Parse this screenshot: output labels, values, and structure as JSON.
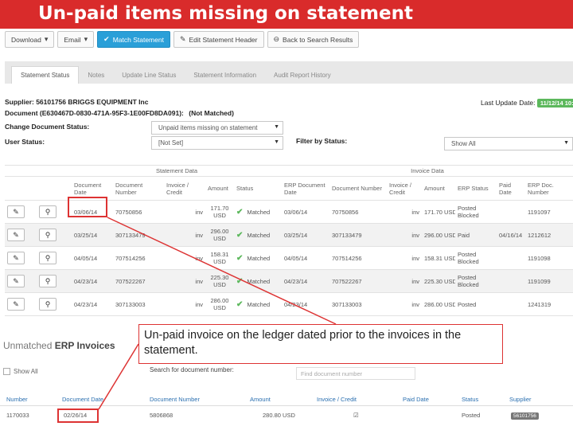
{
  "slide_title": "Un-paid items missing on statement",
  "toolbar": [
    {
      "label": "Download",
      "icon": "caret-down-icon",
      "glyph": "▾"
    },
    {
      "label": "Email",
      "icon": "caret-down-icon",
      "glyph": "▾"
    },
    {
      "label": "Match Statement",
      "icon": "check-circle-icon",
      "glyph": "✔",
      "primary": true
    },
    {
      "label": "Edit Statement Header",
      "icon": "edit-icon",
      "glyph": "✎"
    },
    {
      "label": "Back to Search Results",
      "icon": "back-arrow-icon",
      "glyph": "⊖"
    }
  ],
  "tabs": [
    {
      "label": "Statement Status",
      "active": true
    },
    {
      "label": "Notes"
    },
    {
      "label": "Update Line Status"
    },
    {
      "label": "Statement Information"
    },
    {
      "label": "Audit Report History"
    }
  ],
  "header": {
    "supplier": "Supplier: 56101756 BRIGGS EQUIPMENT Inc",
    "document": "Document (E630467D-0830-471A-95F3-1E00FD8DA091):",
    "doc_status": "(Not Matched)",
    "last_update_label": "Last Update Date:",
    "last_update_value": "11/12/14 10:04",
    "change_status_label": "Change Document Status:",
    "change_status_value": "Unpaid items missing on statement",
    "user_status_label": "User Status:",
    "user_status_value": "[Not Set]",
    "filter_label": "Filter by Status:",
    "filter_value": "Show All"
  },
  "statement_table": {
    "group_statement": "Statement Data",
    "group_invoice": "Invoice Data",
    "columns": [
      "",
      "",
      "Document Date",
      "Document Number",
      "Invoice / Credit",
      "Amount",
      "Status",
      "ERP Document Date",
      "Document Number",
      "Invoice / Credit",
      "Amount",
      "ERP Status",
      "Paid Date",
      "ERP Doc. Number"
    ],
    "rows": [
      {
        "doc_date": "03/06/14",
        "doc_num": "70750856",
        "type": "inv",
        "amount": "171.70 USD",
        "status": "Matched",
        "erp_date": "03/06/14",
        "erp_num": "70750856",
        "erp_type": "inv",
        "erp_amount": "171.70 USD",
        "erp_status": "Posted Blocked",
        "paid_date": "",
        "erp_doc": "1191097"
      },
      {
        "doc_date": "03/25/14",
        "doc_num": "307133479",
        "type": "inv",
        "amount": "296.00 USD",
        "status": "Matched",
        "erp_date": "03/25/14",
        "erp_num": "307133479",
        "erp_type": "inv",
        "erp_amount": "296.00 USD",
        "erp_status": "Paid",
        "paid_date": "04/16/14",
        "erp_doc": "1212612"
      },
      {
        "doc_date": "04/05/14",
        "doc_num": "707514256",
        "type": "inv",
        "amount": "158.31 USD",
        "status": "Matched",
        "erp_date": "04/05/14",
        "erp_num": "707514256",
        "erp_type": "inv",
        "erp_amount": "158.31 USD",
        "erp_status": "Posted Blocked",
        "paid_date": "",
        "erp_doc": "1191098"
      },
      {
        "doc_date": "04/23/14",
        "doc_num": "707522267",
        "type": "inv",
        "amount": "225.30 USD",
        "status": "Matched",
        "erp_date": "04/23/14",
        "erp_num": "707522267",
        "erp_type": "inv",
        "erp_amount": "225.30 USD",
        "erp_status": "Posted Blocked",
        "paid_date": "",
        "erp_doc": "1191099"
      },
      {
        "doc_date": "04/23/14",
        "doc_num": "307133003",
        "type": "inv",
        "amount": "286.00 USD",
        "status": "Matched",
        "erp_date": "04/23/14",
        "erp_num": "307133003",
        "erp_type": "inv",
        "erp_amount": "286.00 USD",
        "erp_status": "Posted",
        "paid_date": "",
        "erp_doc": "1241319"
      }
    ]
  },
  "callout": "Un-paid invoice on the ledger dated prior to the invoices in the statement.",
  "unmatched": {
    "title_plain": "Unmatched",
    "title_bold": "ERP Invoices",
    "show_all": "Show All",
    "search_label": "Search for document number:",
    "search_placeholder": "Find document number",
    "columns": [
      "Number",
      "Document Date",
      "Document Number",
      "Amount",
      "Invoice / Credit",
      "Paid Date",
      "Status",
      "Supplier"
    ],
    "row": {
      "number": "1170033",
      "doc_date": "02/26/14",
      "doc_num": "5806868",
      "amount": "280.80 USD",
      "paid_date": "",
      "status": "Posted",
      "supplier": "56101756"
    }
  },
  "colors": {
    "accent": "#d92b2b",
    "primary_button": "#2a9fd8",
    "matched": "#5cb85c",
    "link": "#2a6fb0"
  }
}
